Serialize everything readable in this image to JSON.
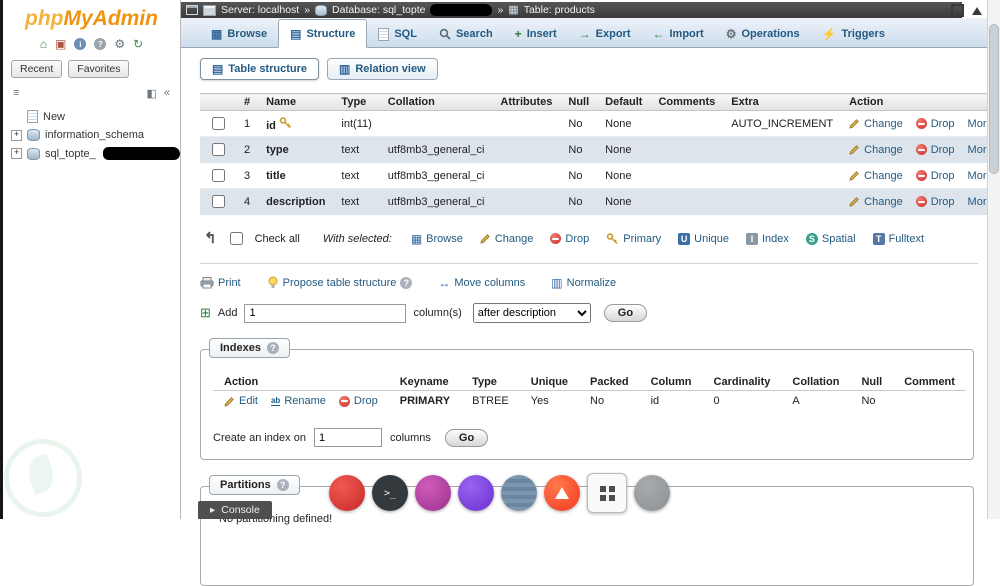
{
  "app": {
    "logo_php": "php",
    "logo_myadmin": "MyAdmin",
    "console": "Console"
  },
  "sidebar": {
    "recent": "Recent",
    "favorites": "Favorites",
    "tree_new": "New",
    "tree_schema": "information_schema",
    "tree_db": "sql_topte_"
  },
  "breadcrumb": {
    "server": "Server: localhost",
    "database": "Database: sql_topte",
    "table": "Table: products",
    "separator": "»"
  },
  "tabs": {
    "browse": "Browse",
    "structure": "Structure",
    "sql": "SQL",
    "search": "Search",
    "insert": "Insert",
    "export": "Export",
    "import": "Import",
    "operations": "Operations",
    "triggers": "Triggers"
  },
  "subtabs": {
    "table_structure": "Table structure",
    "relation_view": "Relation view"
  },
  "structure": {
    "headers": [
      "#",
      "Name",
      "Type",
      "Collation",
      "Attributes",
      "Null",
      "Default",
      "Comments",
      "Extra",
      "Action"
    ],
    "rows": [
      {
        "num": "1",
        "name": "id",
        "type": "int(11)",
        "collation": "",
        "attributes": "",
        "nullable": "No",
        "default_value": "None",
        "comments": "",
        "extra": "AUTO_INCREMENT"
      },
      {
        "num": "2",
        "name": "type",
        "type": "text",
        "collation": "utf8mb3_general_ci",
        "attributes": "",
        "nullable": "No",
        "default_value": "None",
        "comments": "",
        "extra": ""
      },
      {
        "num": "3",
        "name": "title",
        "type": "text",
        "collation": "utf8mb3_general_ci",
        "attributes": "",
        "nullable": "No",
        "default_value": "None",
        "comments": "",
        "extra": ""
      },
      {
        "num": "4",
        "name": "description",
        "type": "text",
        "collation": "utf8mb3_general_ci",
        "attributes": "",
        "nullable": "No",
        "default_value": "None",
        "comments": "",
        "extra": ""
      }
    ],
    "change": "Change",
    "drop": "Drop",
    "more": "More"
  },
  "with_selected": {
    "check_all": "Check all",
    "label": "With selected:",
    "browse": "Browse",
    "change": "Change",
    "drop": "Drop",
    "primary": "Primary",
    "unique": "Unique",
    "index": "Index",
    "spatial": "Spatial",
    "fulltext": "Fulltext"
  },
  "tools": {
    "print": "Print",
    "propose": "Propose table structure",
    "move_columns": "Move columns",
    "normalize": "Normalize"
  },
  "add_column": {
    "label": "Add",
    "count": "1",
    "columns": "column(s)",
    "position": "after description",
    "go": "Go"
  },
  "indexes": {
    "legend": "Indexes",
    "headers": [
      "Action",
      "Keyname",
      "Type",
      "Unique",
      "Packed",
      "Column",
      "Cardinality",
      "Collation",
      "Null",
      "Comment"
    ],
    "edit": "Edit",
    "rename": "Rename",
    "drop": "Drop",
    "row": {
      "keyname": "PRIMARY",
      "type": "BTREE",
      "unique": "Yes",
      "packed": "No",
      "column": "id",
      "cardinality": "0",
      "collation": "A",
      "nullable": "No",
      "comment": ""
    },
    "create_label": "Create an index on",
    "create_count": "1",
    "columns": "columns",
    "go": "Go"
  },
  "partitions": {
    "legend": "Partitions",
    "message": "No partitioning defined!"
  }
}
